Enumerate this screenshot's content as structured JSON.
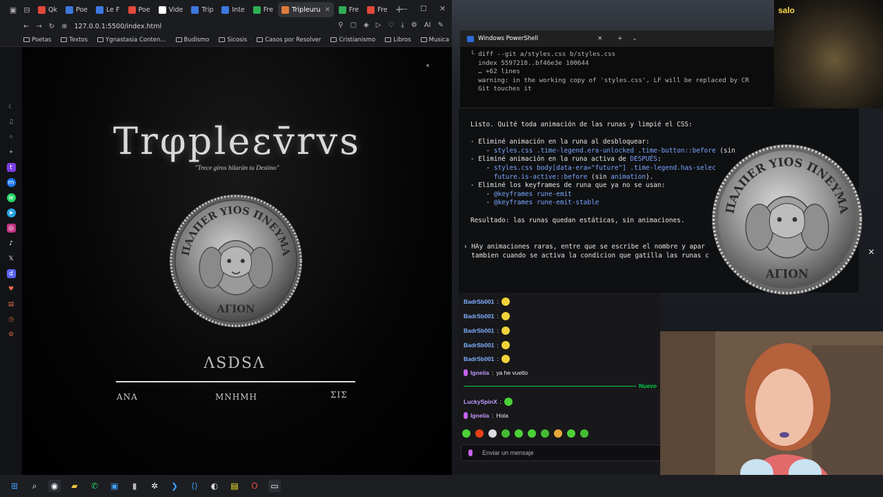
{
  "browser": {
    "tabs": [
      {
        "label": "Qk",
        "color": "#e0493c"
      },
      {
        "label": "Poe",
        "color": "#3c78e0"
      },
      {
        "label": "Le F",
        "color": "#3c78e0"
      },
      {
        "label": "Poe",
        "color": "#e0493c"
      },
      {
        "label": "Vide",
        "color": "#ffffff"
      },
      {
        "label": "Trip",
        "color": "#3c78e0"
      },
      {
        "label": "Inte",
        "color": "#3c78e0"
      },
      {
        "label": "Fre",
        "color": "#2fae55"
      },
      {
        "label": "Tripleuru",
        "color": "#e07a3c",
        "active": true
      },
      {
        "label": "Fre",
        "color": "#2fae55"
      },
      {
        "label": "Fre",
        "color": "#e0493c"
      }
    ],
    "url": "127.0.0.1:5500/index.html",
    "bookmarks": [
      "Poetas",
      "Textos",
      "Ygnastasia Conten...",
      "Budismo",
      "Sicosis",
      "Casos por Resolver",
      "Cristianismo",
      "Libros",
      "Musica"
    ],
    "sidebar_colors": [
      "#7b3fe4",
      "#1877f2",
      "#25d366",
      "#2aa3e6",
      "#c13584",
      "#111111",
      "#111111",
      "#5865f2"
    ]
  },
  "site": {
    "title": "Trφpleεv̄rvs",
    "subtitle": "\"Trece giros hilarán tu Destino\"",
    "coin_top": "ΠΑΛΠΕR ΥΙΟS ΠΝΕΥΜΑ",
    "coin_bottom": "ΑΓΙΟΝ",
    "player_name": "ΛSDSΛ",
    "eras": [
      "ΑΝΑ",
      "ΜΝΗΜΗ",
      "ΣΙΣ"
    ]
  },
  "terminal": {
    "title": "Windows PowerShell",
    "lines": [
      "└ diff --git a/styles.css b/styles.css",
      "  index 5597218..bf46e3e 100644",
      "  … +62 lines",
      "  warning: in the working copy of 'styles.css', LF will be replaced by CR",
      "  Git touches it"
    ]
  },
  "codex": {
    "summary": "Listo. Quité toda animación de las runas y limpié el CSS:",
    "b1": "- Eliminé animación en la runa al desbloquear:",
    "b1_sub_a": "    - ",
    "b1_code": "styles.css .time-legend.era-unlocked .time-button::before",
    "b1_tail": " (sin",
    "b2": "- Eliminé animación en la runa activa de ",
    "b2_hl": "DESPUÉS",
    "b2_end": ":",
    "b2_code": "styles.css body[data-era=\"future\"] .time-legend.has-selec",
    "b2_code2": "future.is-active::before",
    "b2_tail": " (sin ",
    "b2_anim": "animation",
    "b2_close": ").",
    "b3": "- Eliminé los keyframes de runa que ya no se usan:",
    "b3_k1": "@keyframes rune-emit",
    "b3_k2": "@keyframes rune-emit-stable",
    "result": "Resultado: las runas quedan estáticas, sin animaciones.",
    "prompt1": "› HAy animaciones raras, entre que se escribe el nombre y apar",
    "prompt2": "  tambien cuando se activa la condicion que gatilla las runas c"
  },
  "webcam_label": "salo",
  "chat": {
    "messages": [
      {
        "user": "BadrSb001",
        "text": "",
        "color": "#7fb2ff"
      },
      {
        "user": "BadrSb001",
        "text": "",
        "color": "#7fb2ff"
      },
      {
        "user": "BadrSb001",
        "text": "",
        "color": "#7fb2ff"
      },
      {
        "user": "BadrSb001",
        "text": "",
        "color": "#7fb2ff"
      },
      {
        "user": "BadrSb001",
        "text": "",
        "color": "#7fb2ff"
      },
      {
        "user": "Igneiia",
        "text": "ya he vuelto",
        "color": "#c59bff"
      }
    ],
    "new_label": "Nuevo",
    "after": [
      {
        "user": "LuckySpinX",
        "text": "",
        "color": "#c59bff"
      },
      {
        "user": "Igneiia",
        "text": "Hola",
        "color": "#c59bff"
      }
    ],
    "input_placeholder": "Enviar un mensaje"
  }
}
